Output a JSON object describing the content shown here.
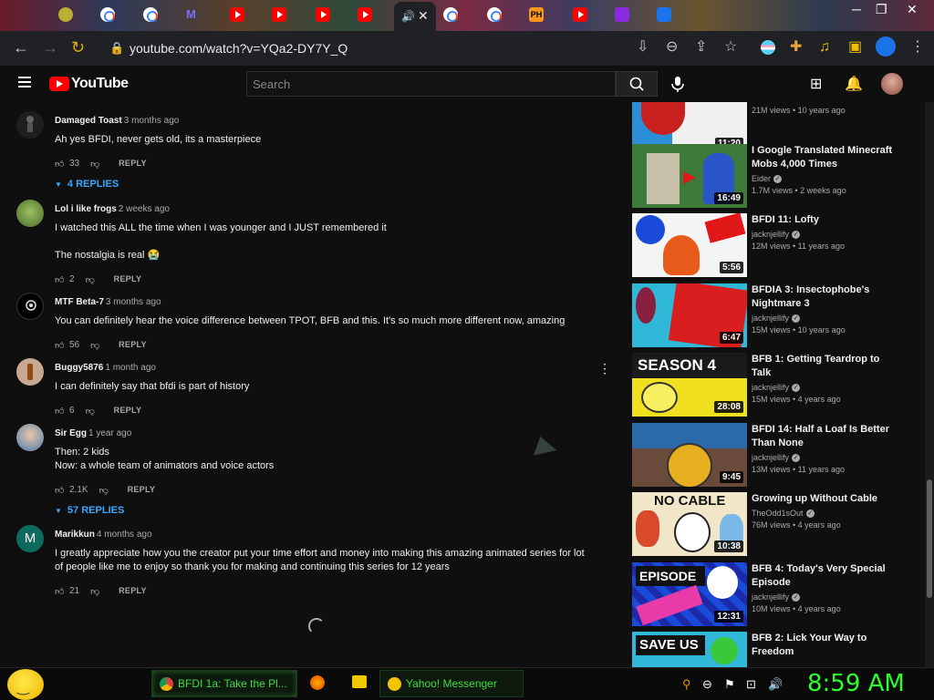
{
  "browser": {
    "active_tab_close": "✕",
    "url": "youtube.com/watch?v=YQa2-DY7Y_Q",
    "fav_ph_text": "PH"
  },
  "youtube": {
    "logo_text": "YouTube",
    "search_placeholder": "Search"
  },
  "comments": [
    {
      "author": "Damaged Toast",
      "time": "3 months ago",
      "text": [
        "Ah yes BFDI, never gets old, its a masterpiece"
      ],
      "likes": "33",
      "reply_label": "REPLY",
      "replies": "4 REPLIES",
      "avatar_color": "#1e1e1e"
    },
    {
      "author": "Lol i like frogs",
      "time": "2 weeks ago",
      "text": [
        "I watched this ALL the time when I was younger and I JUST remembered it",
        "",
        "The nostalgia is real 😭"
      ],
      "likes": "2",
      "reply_label": "REPLY",
      "replies": "",
      "avatar_color": "#6a8a3a"
    },
    {
      "author": "MTF Beta-7",
      "time": "3 months ago",
      "text": [
        "You can definitely hear the voice difference between TPOT, BFB and this. It's so much more different now, amazing"
      ],
      "likes": "56",
      "reply_label": "REPLY",
      "replies": "",
      "avatar_color": "#000000"
    },
    {
      "author": "Buggy5876",
      "time": "1 month ago",
      "text": [
        "I can definitely say that bfdi is part of history"
      ],
      "likes": "6",
      "reply_label": "REPLY",
      "replies": "",
      "avatar_color": "#b08a70"
    },
    {
      "author": "Sir Egg",
      "time": "1 year ago",
      "text": [
        "Then: 2 kids",
        "Now: a whole team of animators and voice actors"
      ],
      "likes": "2.1K",
      "reply_label": "REPLY",
      "replies": "57 REPLIES",
      "avatar_color": "#7aa0c8"
    },
    {
      "author": "Marikkun",
      "time": "4 months ago",
      "text": [
        "I greatly appreciate how you the creator put your time effort and money into making this amazing animated series for lot of people like me to enjoy so thank you for making and continuing this series for 12 years"
      ],
      "likes": "21",
      "reply_label": "REPLY",
      "replies": "",
      "avatar_color": "#0d6b5e",
      "avatar_letter": "M"
    }
  ],
  "sidebar": [
    {
      "title": "",
      "channel": "",
      "stats": "21M views • 10 years ago",
      "duration": "11:20",
      "verified": false,
      "thumb": [
        "#c91f1f",
        "#2b8fd6"
      ]
    },
    {
      "title": "I Google Translated Minecraft Mobs 4,000 Times",
      "channel": "Eider",
      "stats": "1.7M views • 2 weeks ago",
      "duration": "16:49",
      "verified": true,
      "thumb": [
        "#3e7a3a",
        "#2a55c9"
      ]
    },
    {
      "title": "BFDI 11: Lofty",
      "channel": "jacknjellify",
      "stats": "12M views • 11 years ago",
      "duration": "5:56",
      "verified": true,
      "thumb": [
        "#ffffff",
        "#e03a1a"
      ]
    },
    {
      "title": "BFDIA 3: Insectophobe's Nightmare 3",
      "channel": "jacknjellify",
      "stats": "15M views • 10 years ago",
      "duration": "6:47",
      "verified": true,
      "thumb": [
        "#2fb8d8",
        "#d81e1e"
      ]
    },
    {
      "title": "BFB 1: Getting Teardrop to Talk",
      "channel": "jacknjellify",
      "stats": "15M views • 4 years ago",
      "duration": "28:08",
      "verified": true,
      "thumb": [
        "#1a1a1a",
        "#f0e020"
      ],
      "badge": "SEASON 4"
    },
    {
      "title": "BFDI 14: Half a Loaf Is Better Than None",
      "channel": "jacknjellify",
      "stats": "13M views • 11 years ago",
      "duration": "9:45",
      "verified": true,
      "thumb": [
        "#2a6aa8",
        "#e8b020"
      ]
    },
    {
      "title": "Growing up Without Cable",
      "channel": "TheOdd1sOut",
      "stats": "76M views • 4 years ago",
      "duration": "10:38",
      "verified": true,
      "thumb": [
        "#f2e6c8",
        "#d84a2a"
      ],
      "badge": "NO CABLE"
    },
    {
      "title": "BFB 4: Today's Very Special Episode",
      "channel": "jacknjellify",
      "stats": "10M views • 4 years ago",
      "duration": "12:31",
      "verified": true,
      "thumb": [
        "#1a4ad8",
        "#e83aa8"
      ],
      "badge": "EPISODE"
    },
    {
      "title": "BFB 2: Lick Your Way to Freedom",
      "channel": "",
      "stats": "",
      "duration": "",
      "verified": false,
      "thumb": [
        "#1a1a1a",
        "#3ac83a"
      ],
      "badge": "SAVE US"
    }
  ],
  "taskbar": {
    "tasks": [
      {
        "label": "BFDI 1a: Take the Pl...",
        "icon_color": "#db4437"
      },
      {
        "label": "Yahoo! Messenger",
        "icon_color": "#f5c400"
      }
    ],
    "clock": "8:59 AM"
  }
}
